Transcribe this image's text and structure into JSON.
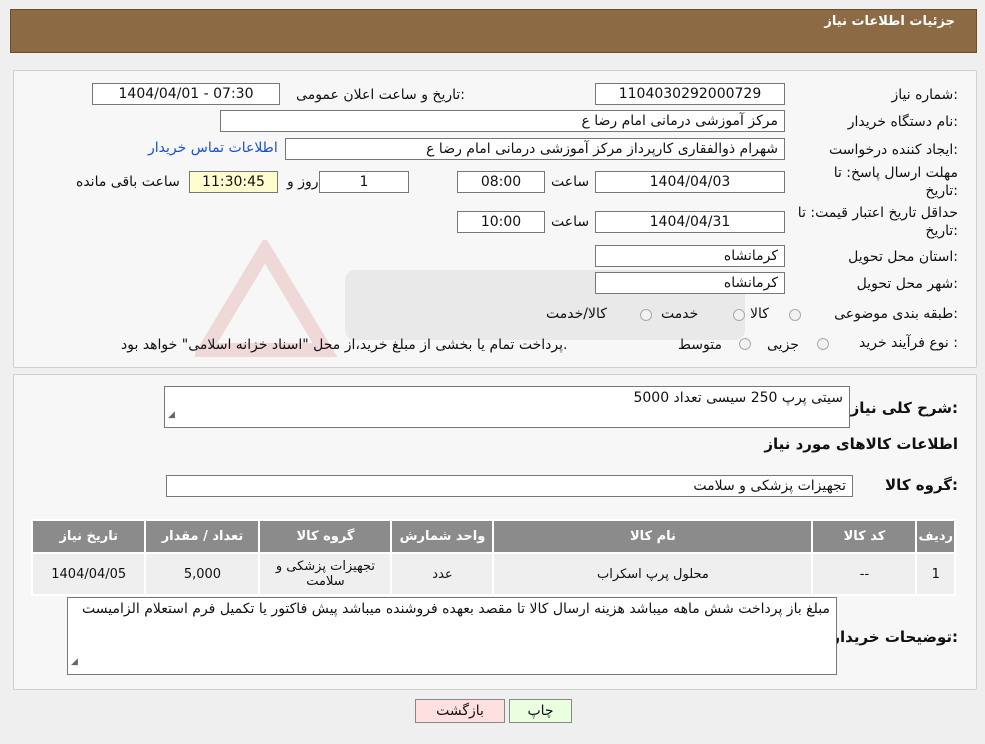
{
  "header": {
    "title": "جزئیات اطلاعات نیاز"
  },
  "info": {
    "need_number_label": "شماره نیاز:",
    "need_number": "1104030292000729",
    "announce_label": "تاریخ و ساعت اعلان عمومی:",
    "announce_value": "1404/04/01 - 07:30",
    "buyer_org_label": "نام دستگاه خریدار:",
    "buyer_org": "مرکز آموزشی  درمانی امام رضا  ع",
    "requester_label": "ایجاد کننده درخواست:",
    "requester": "شهرام ذوالفقاری کارپرداز مرکز آموزشی  درمانی امام رضا  ع",
    "contact_link": "اطلاعات تماس خریدار",
    "deadline_label_1": "مهلت ارسال پاسخ: تا",
    "deadline_label_2": "تاریخ:",
    "deadline_date": "1404/04/03",
    "time_label": "ساعت",
    "deadline_time": "08:00",
    "days_value": "1",
    "days_label": "روز و",
    "remaining_time": "11:30:45",
    "remaining_label": "ساعت باقی مانده",
    "validity_label_1": "حداقل تاریخ اعتبار قیمت: تا",
    "validity_label_2": "تاریخ:",
    "validity_date": "1404/04/31",
    "validity_time": "10:00",
    "province_label": "استان محل تحویل:",
    "province": "کرمانشاه",
    "city_label": "شهر محل تحویل:",
    "city": "کرمانشاه",
    "category_label": "طبقه بندی موضوعی:",
    "category_options": [
      "کالا",
      "خدمت",
      "کالا/خدمت"
    ],
    "purchase_type_label": "نوع فرآیند خرید :",
    "purchase_options": [
      "جزیی",
      "متوسط"
    ],
    "purchase_note": "پرداخت تمام یا بخشی از مبلغ خرید،از محل \"اسناد خزانه اسلامی\" خواهد بود."
  },
  "details": {
    "summary_label": "شرح کلی نیاز:",
    "summary": "سیتی پرپ 250 سیسی تعداد 5000",
    "goods_info_title": "اطلاعات کالاهای مورد نیاز",
    "goods_group_label": "گروه کالا:",
    "goods_group": "تجهیزات پزشکی و سلامت",
    "table_headers": [
      "ردیف",
      "کد کالا",
      "نام کالا",
      "واحد شمارش",
      "گروه کالا",
      "تعداد / مقدار",
      "تاریخ نیاز"
    ],
    "rows": [
      {
        "row": "1",
        "code": "--",
        "name": "محلول پرپ اسکراب",
        "unit": "عدد",
        "group": "تجهیزات پزشکی و سلامت",
        "qty": "5,000",
        "date": "1404/04/05"
      }
    ],
    "buyer_notes_label": "توضیحات خریدار:",
    "buyer_notes": "مبلغ باز پرداخت شش ماهه میباشد هزینه ارسال کالا تا مقصد بعهده فروشنده میباشد پیش فاکتور یا تکمیل فرم استعلام الزامیست"
  },
  "buttons": {
    "print": "چاپ",
    "back": "بازگشت"
  },
  "colors": {
    "header_bg": "#8b6a44",
    "table_header_bg": "#8b8b8b",
    "print_bg": "#eaffe0",
    "back_bg": "#ffe0e0"
  }
}
